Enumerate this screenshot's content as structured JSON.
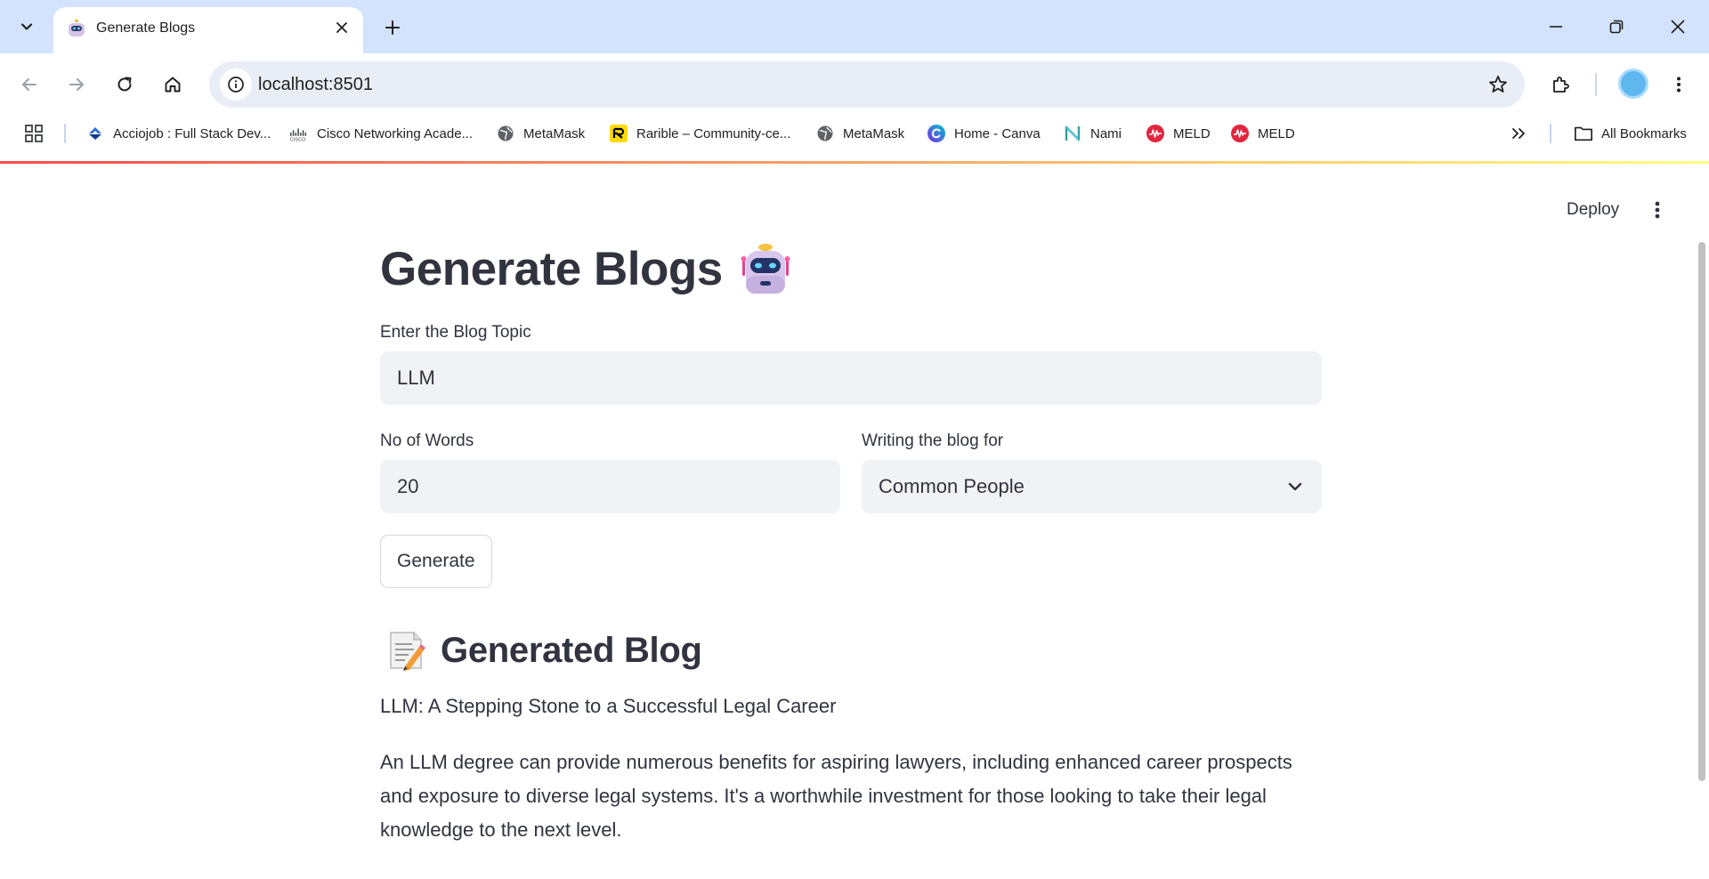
{
  "browser": {
    "tab_title": "Generate Blogs",
    "url": "localhost:8501",
    "bookmarks": [
      {
        "label": "Acciojob : Full Stack Dev...",
        "icon": "acciojob-icon"
      },
      {
        "label": "Cisco Networking Acade...",
        "icon": "cisco-icon"
      },
      {
        "label": "MetaMask",
        "icon": "globe-icon"
      },
      {
        "label": "Rarible – Community-ce...",
        "icon": "rarible-icon"
      },
      {
        "label": "MetaMask",
        "icon": "globe-icon"
      },
      {
        "label": "Home - Canva",
        "icon": "canva-icon"
      },
      {
        "label": "Nami",
        "icon": "nami-icon"
      },
      {
        "label": "MELD",
        "icon": "meld-icon"
      },
      {
        "label": "MELD",
        "icon": "meld-icon"
      }
    ],
    "all_bookmarks": "All Bookmarks",
    "colors": {
      "tabstrip": "#d3e3fd",
      "omnibox": "#e9eef6"
    }
  },
  "app": {
    "deploy_label": "Deploy",
    "title": "Generate Blogs",
    "title_emoji": "robot-emoji",
    "topic_label": "Enter the Blog Topic",
    "topic_value": "LLM",
    "words_label": "No of Words",
    "words_value": "20",
    "audience_label": "Writing the blog for",
    "audience_value": "Common People",
    "generate_label": "Generate",
    "output_heading": "Generated Blog",
    "output_heading_emoji": "memo-emoji",
    "output_title": "LLM: A Stepping Stone to a Successful Legal Career",
    "output_body": "An LLM degree can provide numerous benefits for aspiring lawyers, including enhanced career prospects and exposure to diverse legal systems. It's a worthwhile investment for those looking to take their legal knowledge to the next level.",
    "colors": {
      "text": "#31333f",
      "input_bg": "#f0f2f6",
      "accent": "#ff4b4b"
    }
  }
}
